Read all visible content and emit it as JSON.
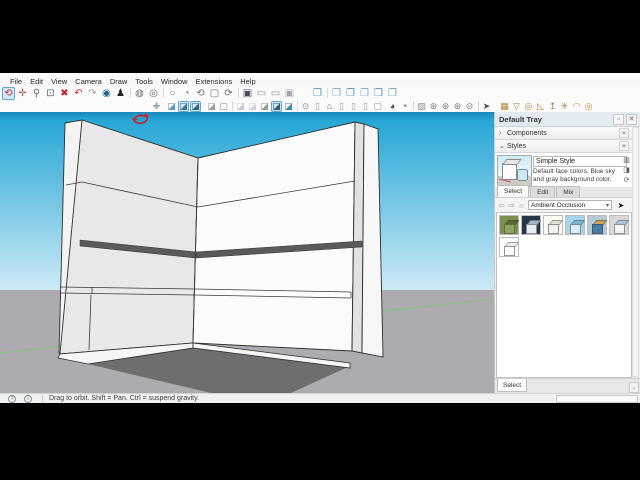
{
  "colors": {
    "sky-top": "#1787b8",
    "sky-hi": "#25a6d5",
    "sky-mid": "#6cc3e4",
    "sky-low": "#cde9f5",
    "ground": "#adabaf",
    "axis-green": "#82c282",
    "shadow": "#6e6d6f",
    "wall-light": "#e8e8e9",
    "wall-lighter": "#f3f3f4",
    "wall-white": "#fcfcfd",
    "endcap-gray": "#e2e2e3",
    "endcap-white": "#f7f7f8",
    "trim": "#f6f6f7",
    "ledge-dark": "#5a5a5a",
    "edge": "#2e2e2e",
    "cursor-red": "#cc2127"
  },
  "menu": {
    "items": [
      {
        "name": "menu-file",
        "label": "File"
      },
      {
        "name": "menu-edit",
        "label": "Edit"
      },
      {
        "name": "menu-view",
        "label": "View"
      },
      {
        "name": "menu-camera",
        "label": "Camera"
      },
      {
        "name": "menu-draw",
        "label": "Draw"
      },
      {
        "name": "menu-tools",
        "label": "Tools"
      },
      {
        "name": "menu-window",
        "label": "Window"
      },
      {
        "name": "menu-extensions",
        "label": "Extensions"
      },
      {
        "name": "menu-help",
        "label": "Help"
      }
    ]
  },
  "toolbar_main": {
    "items": [
      {
        "name": "orbit-icon",
        "glyph": "⟲",
        "color": "#c1272d",
        "selected": true
      },
      {
        "name": "pan-icon",
        "glyph": "✛",
        "color": "#b05a50"
      },
      {
        "name": "zoom-icon",
        "glyph": "⚲",
        "color": "#5a6b75"
      },
      {
        "name": "zoom-window-icon",
        "glyph": "⊡",
        "color": "#5a6b75"
      },
      {
        "name": "zoom-extents-icon",
        "glyph": "✖",
        "color": "#c1272d"
      },
      {
        "name": "previous-view-icon",
        "glyph": "↶",
        "color": "#c1272d"
      },
      {
        "name": "next-view-icon",
        "glyph": "↷",
        "color": "#9aa0a6"
      },
      {
        "name": "look-around-icon",
        "glyph": "◉",
        "color": "#1f5f7d"
      },
      {
        "name": "walk-icon",
        "glyph": "♟",
        "color": "#222222"
      },
      {
        "sep": true
      },
      {
        "name": "xray-icon",
        "glyph": "◍",
        "color": "#6b7176"
      },
      {
        "name": "back-edges-icon",
        "glyph": "◎",
        "color": "#6b7176"
      },
      {
        "sep": true
      },
      {
        "name": "wireframe-icon",
        "glyph": "○",
        "color": "#6b7176"
      },
      {
        "name": "hidden-line-icon",
        "glyph": "◔",
        "color": "#6b7176"
      },
      {
        "name": "shaded-icon",
        "glyph": "⟲",
        "color": "#6b7176"
      },
      {
        "name": "textured-icon",
        "glyph": "▢",
        "color": "#6b7176"
      },
      {
        "name": "monochrome-icon",
        "glyph": "⟳",
        "color": "#6b7176"
      },
      {
        "sep": true
      },
      {
        "name": "scene-image-icon",
        "glyph": "▣",
        "color": "#4a4f54"
      },
      {
        "name": "window-icon",
        "glyph": "▭",
        "color": "#8a9094"
      },
      {
        "name": "window2-icon",
        "glyph": "▭",
        "color": "#8a9094"
      },
      {
        "name": "lock-icon",
        "glyph": "▣",
        "color": "#a5a9ad"
      },
      {
        "gap": 14
      },
      {
        "name": "copy-icon",
        "glyph": "❐",
        "color": "#4f93b8"
      },
      {
        "sep": true
      },
      {
        "name": "paste-icon",
        "glyph": "❐",
        "color": "#7fa9c2"
      },
      {
        "name": "component-icon",
        "glyph": "❐",
        "color": "#4f93b8"
      },
      {
        "name": "group-icon",
        "glyph": "❐",
        "color": "#7fa9c2"
      },
      {
        "name": "ungroup-icon",
        "glyph": "❐",
        "color": "#4f93b8"
      },
      {
        "name": "explode-icon",
        "glyph": "❐",
        "color": "#6fa3bf"
      }
    ]
  },
  "toolbar_styles": {
    "items": [
      {
        "name": "axes-icon",
        "glyph": "✚",
        "color": "#8fa3ad"
      },
      {
        "gap": 3
      },
      {
        "name": "style-cube-blue-icon",
        "glyph": "◪",
        "color": "#5b9bc0"
      },
      {
        "name": "style-cube-shaded-icon",
        "glyph": "◪",
        "color": "#44758f",
        "selected": true
      },
      {
        "name": "style-cube-textured-icon",
        "glyph": "◪",
        "color": "#2f6584",
        "selected": true
      },
      {
        "gap": 4
      },
      {
        "name": "style-cube-gray-icon",
        "glyph": "◪",
        "color": "#97a0a6"
      },
      {
        "name": "style-cube-outline-icon",
        "glyph": "▢",
        "color": "#8a9094"
      },
      {
        "sep": true
      },
      {
        "name": "style-cube-pale1-icon",
        "glyph": "◪",
        "color": "#c3cbd1"
      },
      {
        "name": "style-cube-pale2-icon",
        "glyph": "◪",
        "color": "#cdd4d9"
      },
      {
        "name": "style-cube-olive-icon",
        "glyph": "◪",
        "color": "#94a08c"
      },
      {
        "name": "style-cube-dark-icon",
        "glyph": "◪",
        "color": "#3f5a6b",
        "selected": true
      },
      {
        "name": "style-cube-teal-icon",
        "glyph": "◪",
        "color": "#3d8ea8"
      },
      {
        "sep": true
      },
      {
        "name": "shadows-icon",
        "glyph": "⊙",
        "color": "#8a9094"
      },
      {
        "name": "section-plane-icon",
        "glyph": "▯",
        "color": "#9aa0a6"
      },
      {
        "name": "home-view-icon",
        "glyph": "⌂",
        "color": "#6b7176"
      },
      {
        "name": "view-top-icon",
        "glyph": "▯",
        "color": "#9aa0a6"
      },
      {
        "name": "view-front-icon",
        "glyph": "▯",
        "color": "#9aa0a6"
      },
      {
        "name": "view-side-icon",
        "glyph": "▯",
        "color": "#9aa0a6"
      },
      {
        "name": "view-back-icon",
        "glyph": "▢",
        "color": "#9aa0a6"
      },
      {
        "gap": 3
      },
      {
        "name": "make-component-icon",
        "glyph": "◕",
        "color": "#3f464c"
      },
      {
        "name": "edit-component-icon",
        "glyph": "◔",
        "color": "#3f464c"
      },
      {
        "sep": true
      },
      {
        "name": "section-fill-icon",
        "glyph": "▨",
        "color": "#8a9094"
      },
      {
        "name": "sphere-style1-icon",
        "glyph": "⊛",
        "color": "#7d8387"
      },
      {
        "name": "sphere-style2-icon",
        "glyph": "⊛",
        "color": "#7d8387"
      },
      {
        "name": "sphere-style3-icon",
        "glyph": "⊛",
        "color": "#7d8387"
      },
      {
        "name": "sphere-slice-icon",
        "glyph": "⊝",
        "color": "#7d8387"
      },
      {
        "sep": true
      },
      {
        "name": "select-cursor-icon",
        "glyph": "➤",
        "color": "#4a4f54"
      },
      {
        "gap": 6
      },
      {
        "name": "sandbox-from-contours-icon",
        "glyph": "▦",
        "color": "#b5803c"
      },
      {
        "name": "sandbox-smoove-icon",
        "glyph": "▽",
        "color": "#b5803c"
      },
      {
        "name": "sandbox-stamp-icon",
        "glyph": "◎",
        "color": "#c8862e"
      },
      {
        "name": "sandbox-drape-icon",
        "glyph": "◺",
        "color": "#b5803c"
      },
      {
        "name": "sandbox-add-detail-icon",
        "glyph": "↥",
        "color": "#b5803c"
      },
      {
        "name": "sandbox-flip-edge-icon",
        "glyph": "✳",
        "color": "#b5803c"
      },
      {
        "name": "sandbox-dome-icon",
        "glyph": "◠",
        "color": "#c8862e"
      },
      {
        "name": "sandbox-donut-icon",
        "glyph": "◎",
        "color": "#c8862e"
      }
    ]
  },
  "tray": {
    "title": "Default Tray",
    "pin_glyph": "▫",
    "close_glyph": "✕",
    "sections": {
      "components": {
        "label": "Components",
        "expander": "›",
        "close": "✕"
      },
      "styles": {
        "label": "Styles",
        "expander": "⌄",
        "close": "✕"
      }
    },
    "style_name": "Simple Style",
    "style_description": "Default face colors. Blue sky and gray background color.",
    "style_buttons": [
      {
        "name": "secondary-pane-icon",
        "glyph": "▥"
      },
      {
        "name": "paint-style-icon",
        "glyph": "◨"
      },
      {
        "name": "refresh-style-icon",
        "glyph": "⟳"
      }
    ],
    "tabs": [
      {
        "name": "tab-select",
        "label": "Select",
        "active": true
      },
      {
        "name": "tab-edit",
        "label": "Edit"
      },
      {
        "name": "tab-mix",
        "label": "Mix"
      }
    ],
    "nav": {
      "icons": [
        {
          "name": "back-arrow-icon",
          "glyph": "⇦"
        },
        {
          "name": "forward-arrow-icon",
          "glyph": "⇨"
        },
        {
          "name": "in-model-icon",
          "glyph": "⌂"
        }
      ],
      "dropdown_value": "Ambient Occlusion",
      "dropdown_caret": "▾",
      "details_glyph": "➤"
    },
    "thumbnails": [
      {
        "name": "style-thumb-green",
        "bg": "#7d8f4e",
        "front": "#8fa45c",
        "top": "#55683a"
      },
      {
        "name": "style-thumb-dark",
        "bg": "#273646",
        "front": "#e8eef2",
        "top": "#9fb4c4"
      },
      {
        "name": "style-thumb-sketchy",
        "bg": "#fbfbf8",
        "front": "#f4f2ec",
        "top": "#e3e0d6"
      },
      {
        "name": "style-thumb-cyan",
        "bg": "#a9d3e8",
        "front": "#d8edf7",
        "top": "#7fb8d6"
      },
      {
        "name": "style-thumb-blue-tan",
        "bg": "#b7c9d6",
        "front": "#4a7ba6",
        "top": "#c9a45c"
      },
      {
        "name": "style-thumb-gray",
        "bg": "#d9d9d9",
        "front": "#f5f5f5",
        "top": "#aac6dd"
      },
      {
        "name": "style-thumb-lineart",
        "bg": "#ffffff",
        "front": "#fdfdfd",
        "top": "#eeeeee"
      }
    ],
    "bottom_tab": "Select",
    "bottom_caret": "⌄"
  },
  "statusbar": {
    "icons": [
      {
        "name": "geolocate-help-icon",
        "glyph": "?"
      },
      {
        "name": "instructor-info-icon",
        "glyph": "i"
      }
    ],
    "message": "Drag to orbit. Shift = Pan. Ctrl = suspend gravity."
  }
}
